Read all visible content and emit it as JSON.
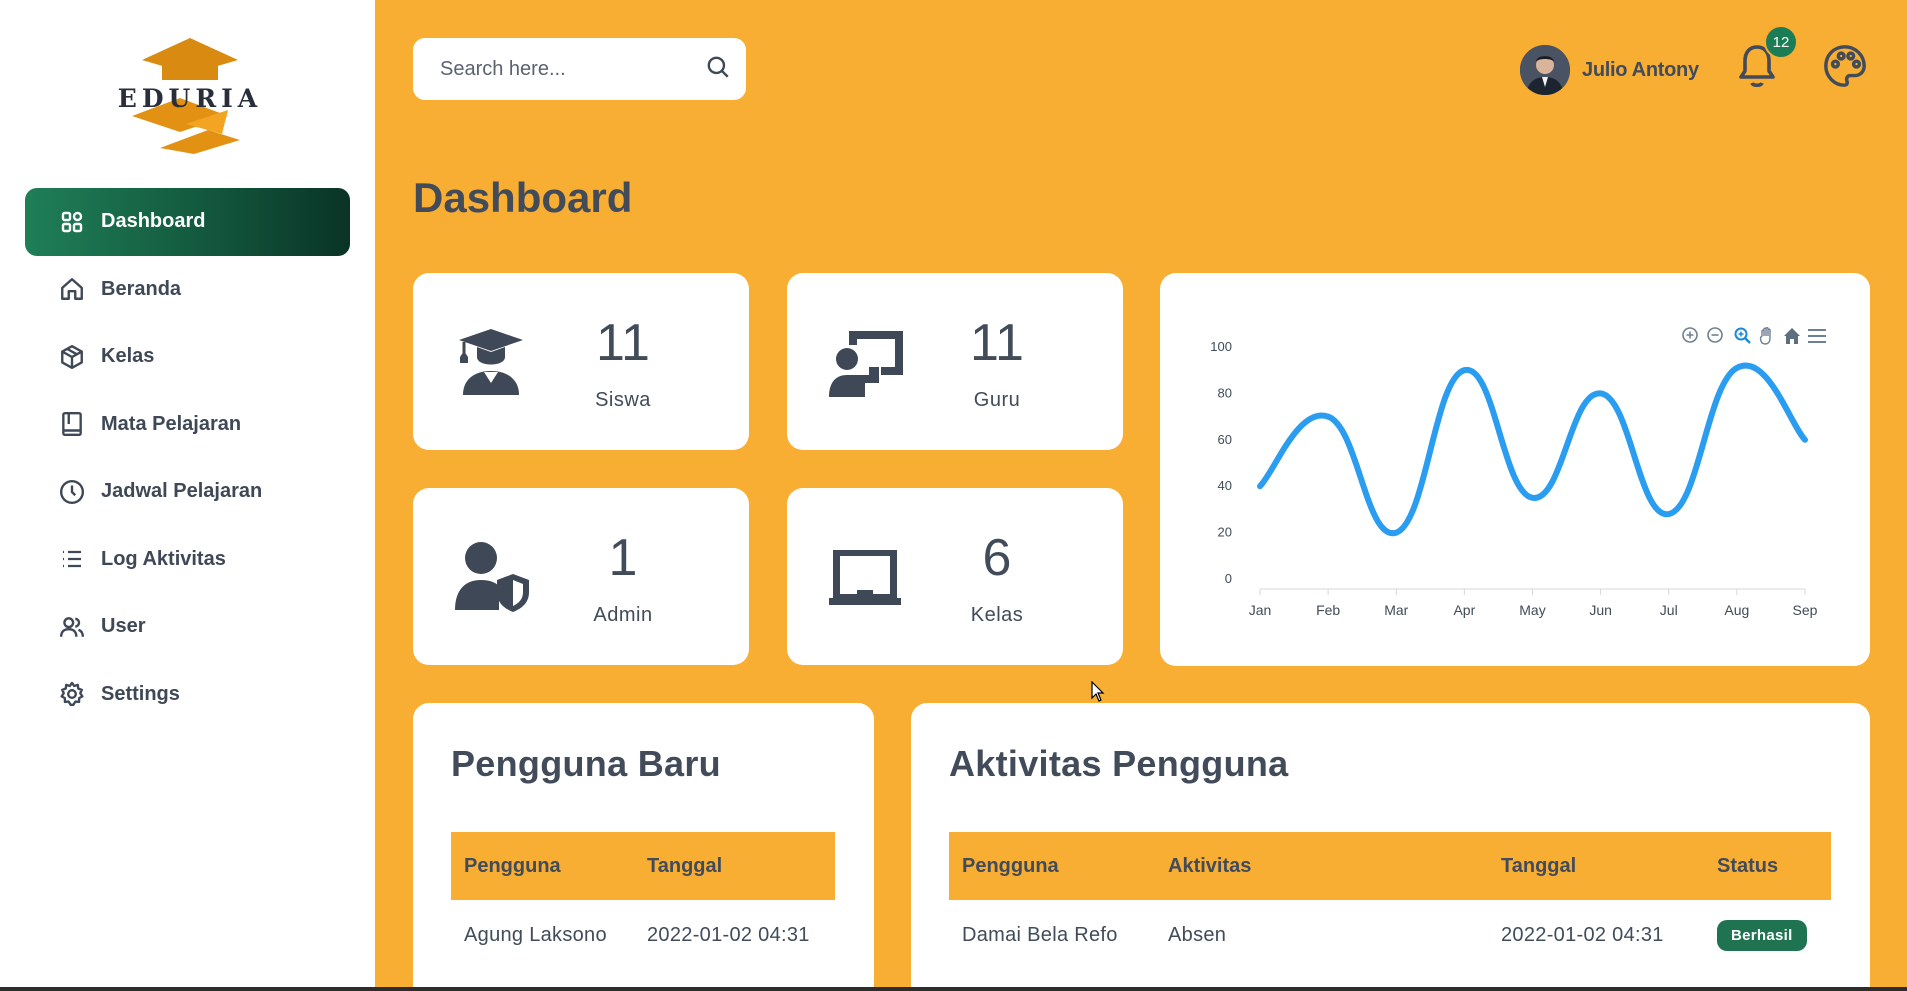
{
  "brand": {
    "logo_text": "EDURIA"
  },
  "sidebar": {
    "items": [
      {
        "label": "Dashboard",
        "icon": "dashboard-grid-icon",
        "active": true
      },
      {
        "label": "Beranda",
        "icon": "home-icon"
      },
      {
        "label": "Kelas",
        "icon": "box-icon"
      },
      {
        "label": "Mata Pelajaran",
        "icon": "book-icon"
      },
      {
        "label": "Jadwal Pelajaran",
        "icon": "clock-icon"
      },
      {
        "label": "Log Aktivitas",
        "icon": "list-icon"
      },
      {
        "label": "User",
        "icon": "users-icon"
      },
      {
        "label": "Settings",
        "icon": "gear-icon"
      }
    ]
  },
  "header": {
    "search_placeholder": "Search here...",
    "user_name": "Julio Antony",
    "notification_count": "12"
  },
  "page": {
    "title": "Dashboard"
  },
  "stats": [
    {
      "value": "11",
      "label": "Siswa",
      "icon": "graduate-icon"
    },
    {
      "value": "11",
      "label": "Guru",
      "icon": "teacher-icon"
    },
    {
      "value": "1",
      "label": "Admin",
      "icon": "admin-shield-icon"
    },
    {
      "value": "6",
      "label": "Kelas",
      "icon": "classroom-board-icon"
    }
  ],
  "chart_data": {
    "type": "line",
    "smooth": true,
    "categories": [
      "Jan",
      "Feb",
      "Mar",
      "Apr",
      "May",
      "Jun",
      "Jul",
      "Aug",
      "Sep"
    ],
    "values": [
      40,
      70,
      20,
      90,
      35,
      80,
      28,
      91,
      60
    ],
    "ylim": [
      0,
      100
    ],
    "yticks": [
      0,
      20,
      40,
      60,
      80,
      100
    ],
    "color": "#2b9df0",
    "toolbar": [
      "zoom-in-icon",
      "zoom-out-icon",
      "zoom-select-icon",
      "pan-hand-icon",
      "reset-home-icon",
      "menu-icon"
    ]
  },
  "new_users": {
    "title": "Pengguna Baru",
    "columns": [
      "Pengguna",
      "Tanggal"
    ],
    "rows": [
      [
        "Agung Laksono",
        "2022-01-02 04:31"
      ]
    ]
  },
  "activity": {
    "title": "Aktivitas Pengguna",
    "columns": [
      "Pengguna",
      "Aktivitas",
      "Tanggal",
      "Status"
    ],
    "rows": [
      [
        "Damai Bela Refo",
        "Absen",
        "2022-01-02 04:31",
        "Berhasil"
      ]
    ]
  },
  "colors": {
    "background": "#f8ad33",
    "accent": "#1c7c55",
    "text": "#414b59"
  }
}
